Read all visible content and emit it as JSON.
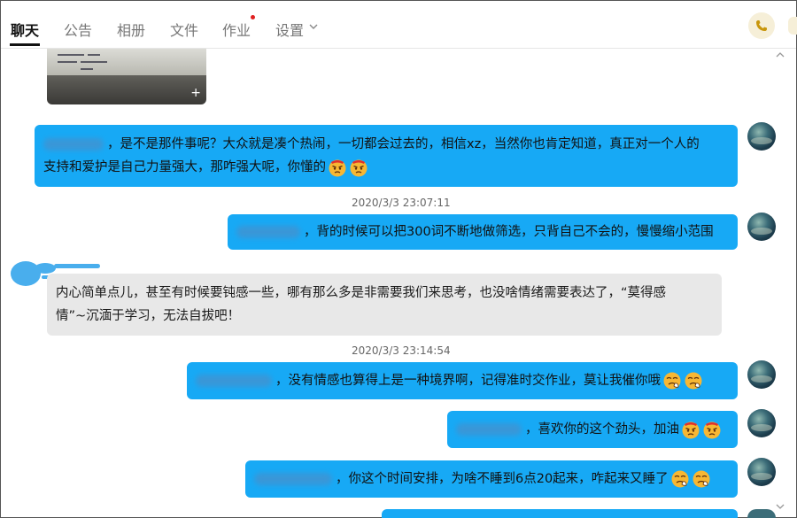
{
  "tabs": [
    {
      "label": "聊天",
      "active": true
    },
    {
      "label": "公告"
    },
    {
      "label": "相册"
    },
    {
      "label": "文件"
    },
    {
      "label": "作业",
      "has_notification_dot": true
    },
    {
      "label": "设置"
    }
  ],
  "header_icons": {
    "call": "phone-icon",
    "settings_dropdown": "chevron-down-icon"
  },
  "colors": {
    "my_bubble": "#17a9f5",
    "other_bubble": "#e8e8e8",
    "accent_dot": "#e02020",
    "phone_btn_bg": "#f6efd8",
    "phone_icon": "#c8960c"
  },
  "messages": [
    {
      "id": "m1",
      "from": "me",
      "lines": [
        "，是不是那件事呢？大众就是凑个热闹，一切都会过去的，相信xz，当然你也肯定知道，真正对一个人的",
        "支持和爱护是自己力量强大，那咋强大呢，你懂的"
      ],
      "emojis": [
        "angry-face-icon",
        "angry-face-icon"
      ]
    },
    {
      "id": "ts1",
      "timestamp": "2020/3/3 23:07:11"
    },
    {
      "id": "m2",
      "from": "me",
      "lines": [
        "，背的时候可以把300词不断地做筛选，只背自己不会的，慢慢缩小范围"
      ]
    },
    {
      "id": "m3",
      "from": "other",
      "lines": [
        "内心简单点儿，甚至有时候要钝感一些，哪有那么多是非需要我们来思考，也没啥情绪需要表达了，“莫得感",
        "情”~沉湎于学习，无法自拔吧！"
      ]
    },
    {
      "id": "ts2",
      "timestamp": "2020/3/3 23:14:54"
    },
    {
      "id": "m4",
      "from": "me",
      "lines": [
        "，没有情感也算得上是一种境界啊，记得准时交作业，莫让我催你哦"
      ],
      "emojis": [
        "sleepy-face-icon",
        "sleepy-face-icon"
      ]
    },
    {
      "id": "m5",
      "from": "me",
      "lines": [
        "，喜欢你的这个劲头，加油"
      ],
      "emojis": [
        "angry-face-icon",
        "angry-face-icon"
      ]
    },
    {
      "id": "m6",
      "from": "me",
      "lines": [
        "，你这个时间安排，为啥不睡到6点20起来，咋起来又睡了"
      ],
      "emojis": [
        "sleepy-face-icon",
        "sleepy-face-icon"
      ]
    }
  ]
}
